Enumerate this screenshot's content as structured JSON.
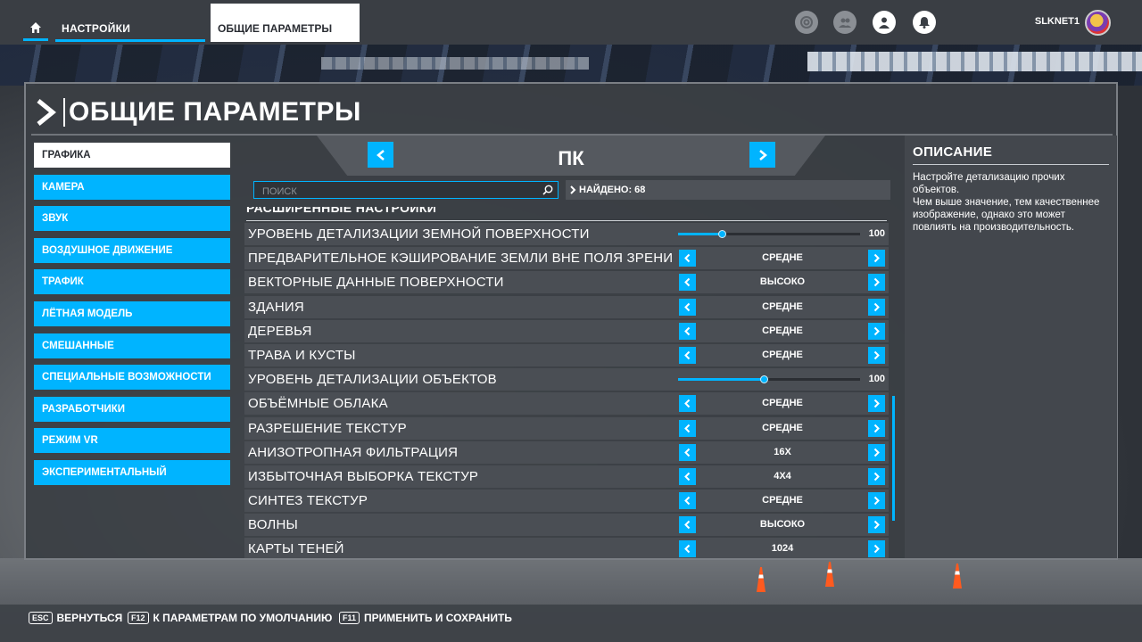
{
  "topbar": {
    "home_icon": "home-icon",
    "tab_settings": "НАСТРОЙКИ",
    "tab_general": "ОБЩИЕ ПАРАМЕТРЫ",
    "icons": [
      "activity-icon",
      "friends-icon",
      "profile-icon",
      "notifications-icon"
    ],
    "username": "SLKNET1"
  },
  "panel": {
    "title": "ОБЩИЕ ПАРАМЕТРЫ"
  },
  "nav": {
    "items": [
      {
        "label": "ГРАФИКА",
        "active": true
      },
      {
        "label": "КАМЕРА",
        "active": false
      },
      {
        "label": "ЗВУК",
        "active": false
      },
      {
        "label": "ВОЗДУШНОЕ ДВИЖЕНИЕ",
        "active": false
      },
      {
        "label": "ТРАФИК",
        "active": false
      },
      {
        "label": "ЛЁТНАЯ МОДЕЛЬ",
        "active": false
      },
      {
        "label": "СМЕШАННЫЕ",
        "active": false
      },
      {
        "label": "СПЕЦИАЛЬНЫЕ ВОЗМОЖНОСТИ",
        "active": false
      },
      {
        "label": "РАЗРАБОТЧИКИ",
        "active": false
      },
      {
        "label": "РЕЖИМ VR",
        "active": false
      },
      {
        "label": "ЭКСПЕРИМЕНТАЛЬНЫЙ",
        "active": false
      }
    ]
  },
  "center": {
    "platform": "ПК",
    "search_placeholder": "ПОИСК",
    "found": "НАЙДЕНО: 68",
    "section": "РАСШИРЕННЫЕ НАСТРОЙКИ",
    "rows": [
      {
        "label": "УРОВЕНЬ ДЕТАЛИЗАЦИИ ЗЕМНОЙ ПОВЕРХНОСТИ",
        "type": "slider",
        "value": "100",
        "fraction": 0.24
      },
      {
        "label": "ПРЕДВАРИТЕЛЬНОЕ КЭШИРОВАНИЕ ЗЕМЛИ ВНЕ ПОЛЯ ЗРЕНИ",
        "type": "select",
        "value": "СРЕДНЕ"
      },
      {
        "label": "ВЕКТОРНЫЕ ДАННЫЕ ПОВЕРХНОСТИ",
        "type": "select",
        "value": "ВЫСОКО"
      },
      {
        "label": "ЗДАНИЯ",
        "type": "select",
        "value": "СРЕДНЕ"
      },
      {
        "label": "ДЕРЕВЬЯ",
        "type": "select",
        "value": "СРЕДНЕ"
      },
      {
        "label": "ТРАВА И КУСТЫ",
        "type": "select",
        "value": "СРЕДНЕ"
      },
      {
        "label": "УРОВЕНЬ ДЕТАЛИЗАЦИИ ОБЪЕКТОВ",
        "type": "slider",
        "value": "100",
        "fraction": 0.47
      },
      {
        "label": "ОБЪЁМНЫЕ ОБЛАКА",
        "type": "select",
        "value": "СРЕДНЕ"
      },
      {
        "label": "РАЗРЕШЕНИЕ ТЕКСТУР",
        "type": "select",
        "value": "СРЕДНЕ"
      },
      {
        "label": "АНИЗОТРОПНАЯ ФИЛЬТРАЦИЯ",
        "type": "select",
        "value": "16X"
      },
      {
        "label": "ИЗБЫТОЧНАЯ ВЫБОРКА ТЕКСТУР",
        "type": "select",
        "value": "4X4"
      },
      {
        "label": "СИНТЕЗ ТЕКСТУР",
        "type": "select",
        "value": "СРЕДНЕ"
      },
      {
        "label": "ВОЛНЫ",
        "type": "select",
        "value": "ВЫСОКО"
      },
      {
        "label": "КАРТЫ ТЕНЕЙ",
        "type": "select",
        "value": "1024"
      }
    ]
  },
  "description": {
    "title": "ОПИСАНИЕ",
    "text": "Настройте детализацию прочих объектов.\nЧем выше значение, тем качественнее изображение, однако это может повлиять на производительность."
  },
  "footer": {
    "items": [
      {
        "key": "ESC",
        "label": "ВЕРНУТЬСЯ"
      },
      {
        "key": "F12",
        "label": "К ПАРАМЕТРАМ ПО УМОЛЧАНИЮ"
      },
      {
        "key": "F11",
        "label": "ПРИМЕНИТЬ И СОХРАНИТЬ"
      }
    ]
  },
  "colors": {
    "accent": "#00b4ff",
    "panel": "#3a3e44"
  }
}
